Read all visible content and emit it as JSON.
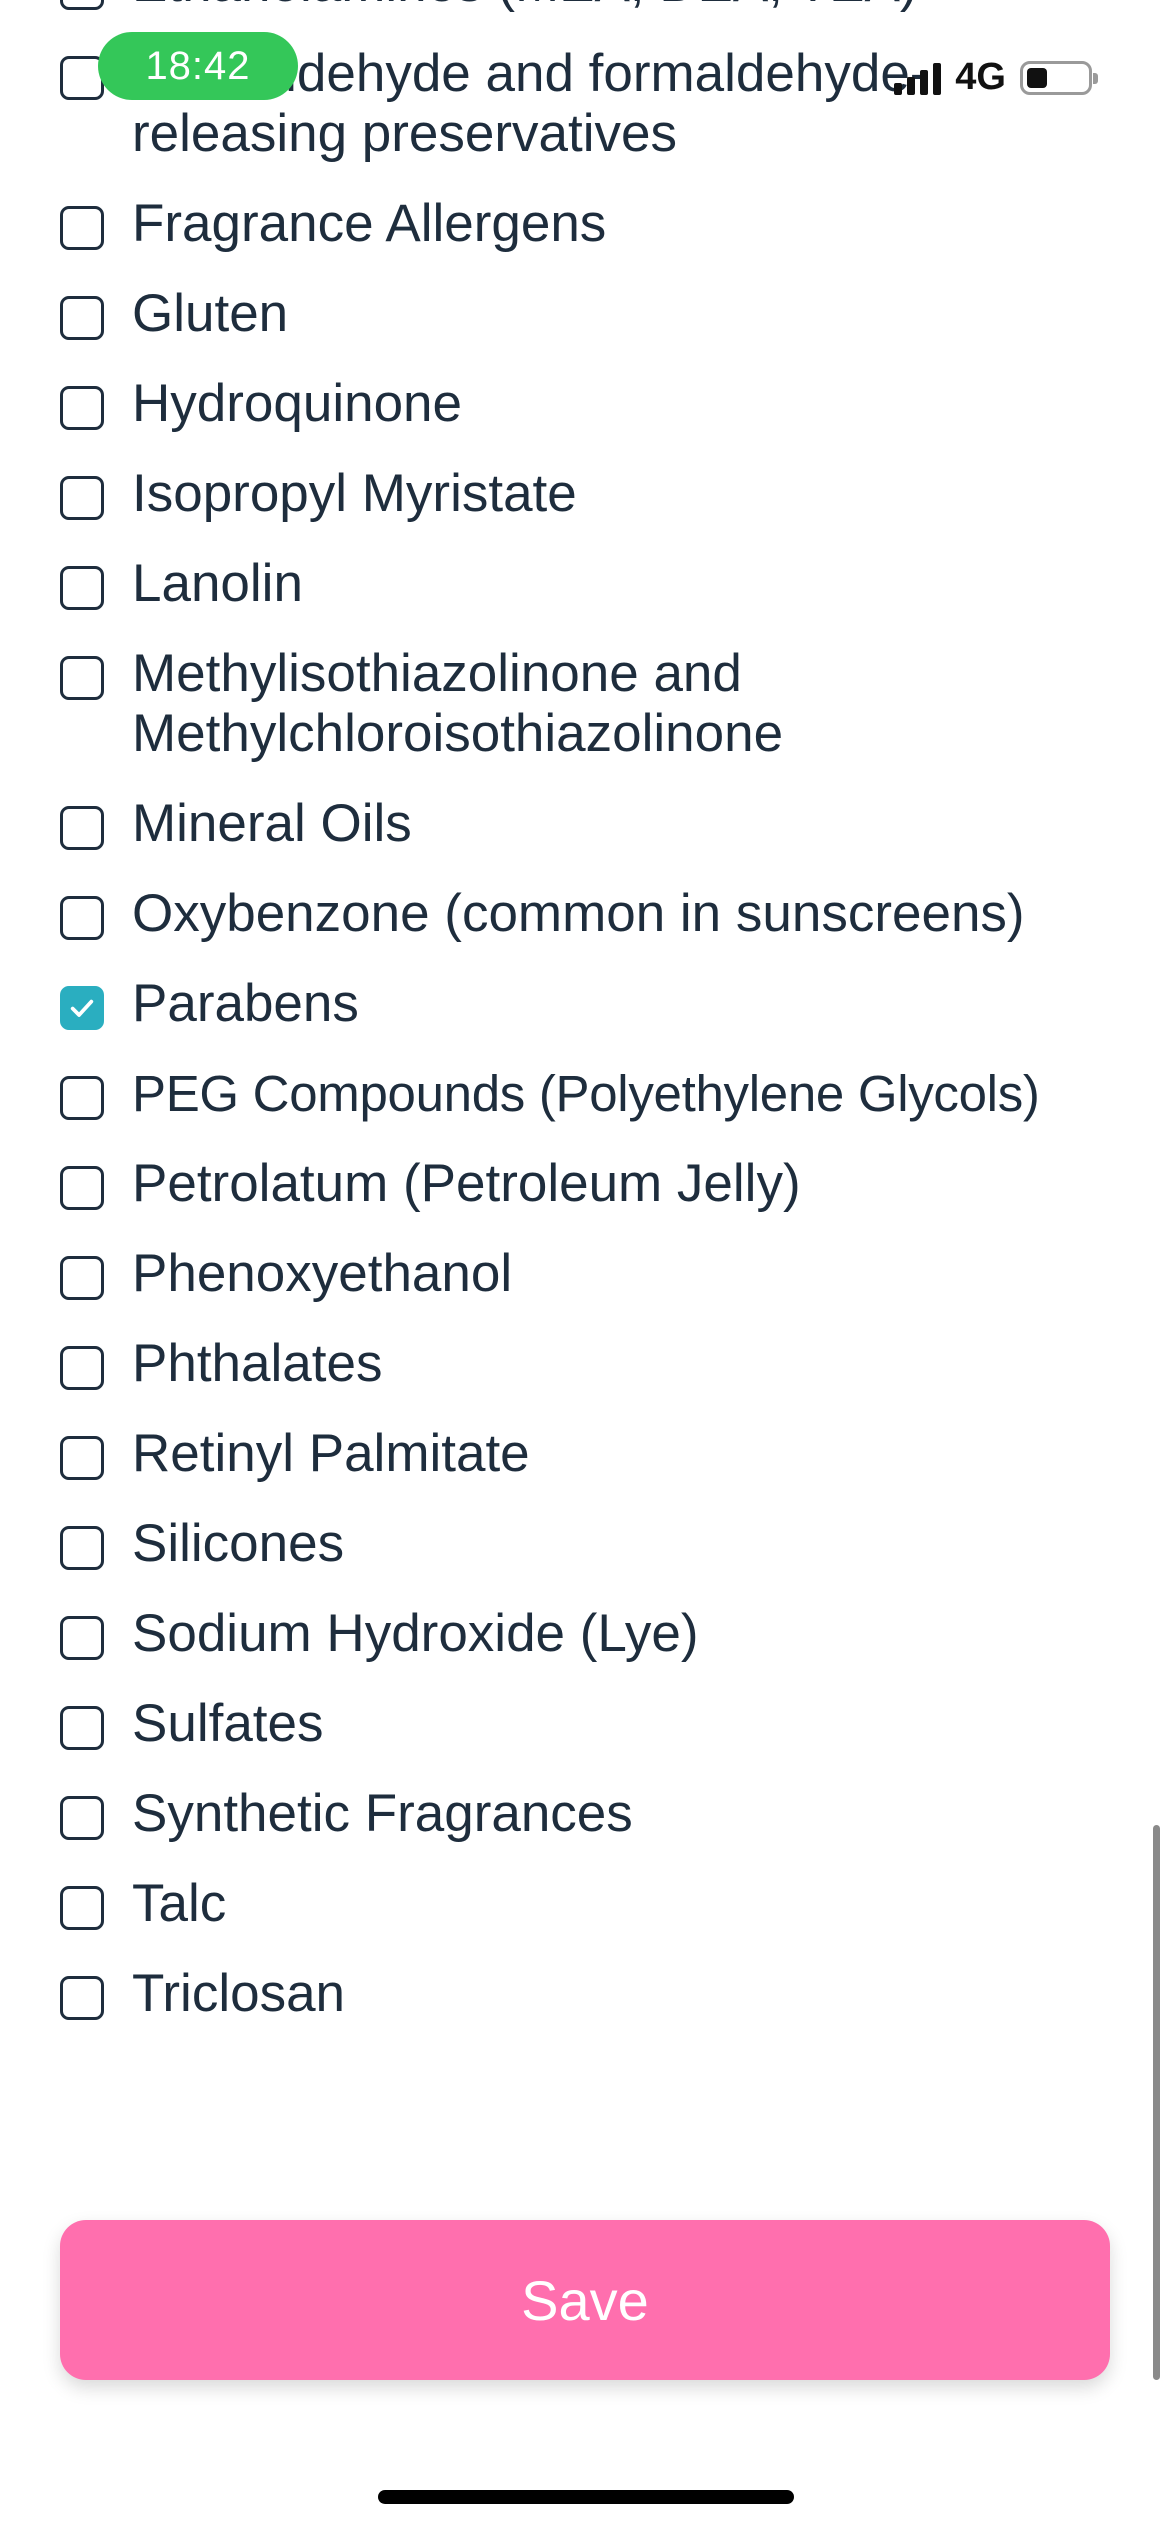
{
  "status_bar": {
    "time": "18:42",
    "network": "4G",
    "signal_icon": "cellular-signal-icon",
    "battery_icon": "battery-icon",
    "battery_level": 0.35,
    "time_pill_color": "#34c759"
  },
  "ingredients": {
    "items": [
      {
        "label": "Ethanolamines (MEA, DEA, TEA)",
        "checked": false
      },
      {
        "label": "Formaldehyde and formaldehyde-releasing preservatives",
        "checked": false
      },
      {
        "label": "Fragrance Allergens",
        "checked": false
      },
      {
        "label": "Gluten",
        "checked": false
      },
      {
        "label": "Hydroquinone",
        "checked": false
      },
      {
        "label": "Isopropyl Myristate",
        "checked": false
      },
      {
        "label": "Lanolin",
        "checked": false
      },
      {
        "label": "Methylisothiazolinone and Methylchloroisothiazolinone",
        "checked": false
      },
      {
        "label": "Mineral Oils",
        "checked": false
      },
      {
        "label": "Oxybenzone (common in sunscreens)",
        "checked": false
      },
      {
        "label": "Parabens",
        "checked": true
      },
      {
        "label": "PEG Compounds (Polyethylene Glycols)",
        "checked": false
      },
      {
        "label": "Petrolatum (Petroleum Jelly)",
        "checked": false
      },
      {
        "label": "Phenoxyethanol",
        "checked": false
      },
      {
        "label": "Phthalates",
        "checked": false
      },
      {
        "label": "Retinyl Palmitate",
        "checked": false
      },
      {
        "label": "Silicones",
        "checked": false
      },
      {
        "label": "Sodium Hydroxide (Lye)",
        "checked": false
      },
      {
        "label": "Sulfates",
        "checked": false
      },
      {
        "label": "Synthetic Fragrances",
        "checked": false
      },
      {
        "label": "Talc",
        "checked": false
      },
      {
        "label": "Triclosan",
        "checked": false
      }
    ]
  },
  "save_button": {
    "label": "Save",
    "color": "#ff6fae"
  },
  "colors": {
    "checked": "#2aaec0",
    "text": "#1e2d3d"
  }
}
